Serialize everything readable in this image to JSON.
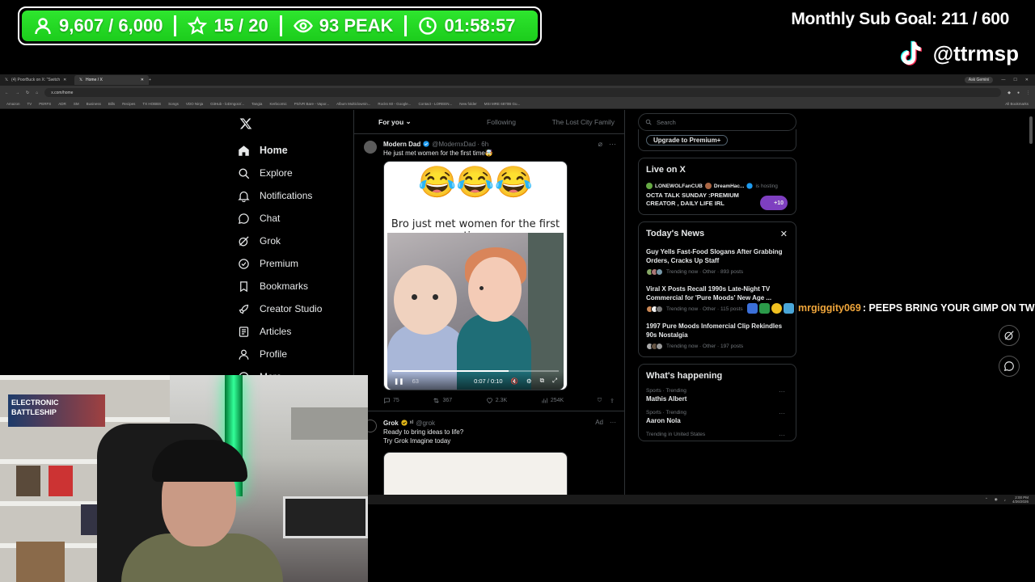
{
  "overlay": {
    "stats": [
      {
        "icon": "user-icon",
        "value": "9,607 / 6,000"
      },
      {
        "icon": "star-icon",
        "value": "15 / 20"
      },
      {
        "icon": "eye-icon",
        "value": "93 PEAK"
      },
      {
        "icon": "timer-icon",
        "value": "01:58:57"
      }
    ],
    "sub_goal": "Monthly Sub Goal:  211 / 600",
    "tiktok_handle": "@ttrmsp",
    "colors": {
      "stat_green": "#22d822",
      "chat_user": "#f0a63b"
    }
  },
  "chat": {
    "user": "mrgiggity069",
    "message": ": PEEPS BRING YOUR GIMP ON TW"
  },
  "browser": {
    "tabs": [
      {
        "label": "(4) PoorBuck on X: \"Switch",
        "active": false
      },
      {
        "label": "Home / X",
        "active": true
      }
    ],
    "ask_gemini": "Ask Gemini",
    "url": "x.com/home",
    "bookmarks": [
      "Amazon",
      "TV",
      "PERFS",
      "ADR",
      "SM",
      "Business",
      "Bills",
      "Recipes",
      "TX HOBBS",
      "Songs",
      "VDO Ninja",
      "GitHub - loDrngoU/...",
      "Tangia",
      "Kerbcomic",
      "PS/VR Bare - Vapor...",
      "Album Multiclownin...",
      "Rocks 60 - Google...",
      "Contact - LOREEN...",
      "New folder",
      "MSI MRE 6870B Gu..."
    ],
    "all_bookmarks": "All Bookmarks"
  },
  "nav": {
    "items": [
      {
        "icon": "home-icon",
        "label": "Home",
        "active": true
      },
      {
        "icon": "search-icon",
        "label": "Explore"
      },
      {
        "icon": "bell-icon",
        "label": "Notifications"
      },
      {
        "icon": "chat-icon",
        "label": "Chat"
      },
      {
        "icon": "grok-icon",
        "label": "Grok"
      },
      {
        "icon": "premium-icon",
        "label": "Premium"
      },
      {
        "icon": "bookmark-icon",
        "label": "Bookmarks"
      },
      {
        "icon": "rocket-icon",
        "label": "Creator Studio"
      },
      {
        "icon": "article-icon",
        "label": "Articles"
      },
      {
        "icon": "profile-icon",
        "label": "Profile"
      },
      {
        "icon": "more-icon",
        "label": "More"
      }
    ]
  },
  "feed": {
    "tabs": [
      "For you",
      "Following",
      "The Lost City Family"
    ],
    "tweet1": {
      "name": "Modern Dad",
      "handle": "@ModernxDad · 6h",
      "text": "He just met women for the first time🤯",
      "media_emojis": "😂😂😂",
      "media_caption": "Bro just met women for the first time",
      "video_time": "0:07 / 0:10",
      "video_progress": 0.7,
      "video_label": "63",
      "replies": "75",
      "reposts": "367",
      "likes": "2.3K",
      "views": "254K"
    },
    "tweet2": {
      "name": "Grok",
      "handle": "@grok",
      "badge": "xI",
      "ad_label": "Ad",
      "text_line1": "Ready to bring ideas to life?",
      "text_line2": "Try Grok Imagine today"
    }
  },
  "sidebar": {
    "search_placeholder": "Search",
    "premium_button": "Upgrade to Premium+",
    "live": {
      "title": "Live on X",
      "host1": "LONEWOLFanCUB",
      "host2": "DreamHac...",
      "status": "is hosting",
      "stream_title": "OCTA TALK SUNDAY :PREMIUM CREATOR , DAILY LIFE IRL",
      "plus_count": "+10"
    },
    "news": {
      "title": "Today's News",
      "items": [
        {
          "title": "Guy Yells Fast-Food Slogans After Grabbing Orders, Cracks Up Staff",
          "meta": "Trending now · Other · 893 posts"
        },
        {
          "title": "Viral X Posts Recall 1990s Late-Night TV Commercial for 'Pure Moods' New Age ...",
          "meta": "Trending now · Other · 115 posts"
        },
        {
          "title": "1997 Pure Moods Infomercial Clip Rekindles 90s Nostalgia",
          "meta": "Trending now · Other · 197 posts"
        }
      ]
    },
    "happening": {
      "title": "What's happening",
      "items": [
        {
          "category": "Sports · Trending",
          "name": "Mathis Albert"
        },
        {
          "category": "Sports · Trending",
          "name": "Aaron Nola"
        },
        {
          "category": "Trending in United States",
          "name": ""
        }
      ]
    }
  },
  "taskbar": {
    "time": "2:00 PM",
    "date": "4/26/2026"
  },
  "webcam": {
    "monitor_text": "ELECTRONIC BATTLESHIP"
  }
}
